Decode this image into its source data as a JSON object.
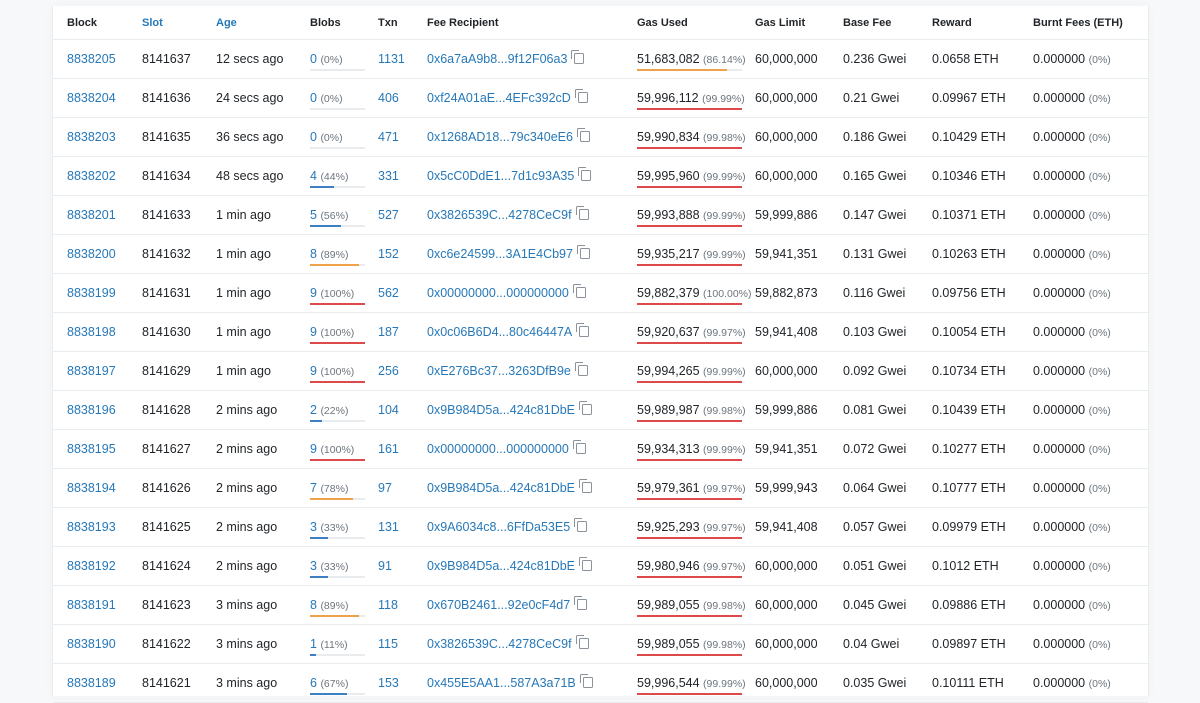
{
  "columns": [
    {
      "label": "Block",
      "sortable": false
    },
    {
      "label": "Slot",
      "sortable": true
    },
    {
      "label": "Age",
      "sortable": true
    },
    {
      "label": "Blobs",
      "sortable": false
    },
    {
      "label": "Txn",
      "sortable": false
    },
    {
      "label": "Fee Recipient",
      "sortable": false
    },
    {
      "label": "Gas Used",
      "sortable": false
    },
    {
      "label": "Gas Limit",
      "sortable": false
    },
    {
      "label": "Base Fee",
      "sortable": false
    },
    {
      "label": "Reward",
      "sortable": false
    },
    {
      "label": "Burnt Fees (ETH)",
      "sortable": false
    }
  ],
  "colors": {
    "link": "#2678b8",
    "blob_bar_low": "#3e7fc1",
    "blob_bar_high": "#f0a14b",
    "blob_bar_full": "#de4a4a",
    "gas_bar_mid": "#f0a14b",
    "gas_bar_high": "#de4a4a"
  },
  "rows": [
    {
      "block": "8838205",
      "slot": "8141637",
      "age": "12 secs ago",
      "blobs": "0",
      "blobs_pct": "(0%)",
      "blobs_frac": 0.0,
      "txn": "1131",
      "fee_recipient": "0x6a7aA9b8...9f12F06a3",
      "gas_used": "51,683,082",
      "gas_pct": "(86.14%)",
      "gas_frac": 0.8614,
      "gas_limit": "60,000,000",
      "base_fee": "0.236 Gwei",
      "reward": "0.0658 ETH",
      "burnt": "0.000000",
      "burnt_pct": "(0%)"
    },
    {
      "block": "8838204",
      "slot": "8141636",
      "age": "24 secs ago",
      "blobs": "0",
      "blobs_pct": "(0%)",
      "blobs_frac": 0.0,
      "txn": "406",
      "fee_recipient": "0xf24A01aE...4EFc392cD",
      "gas_used": "59,996,112",
      "gas_pct": "(99.99%)",
      "gas_frac": 0.9999,
      "gas_limit": "60,000,000",
      "base_fee": "0.21 Gwei",
      "reward": "0.09967 ETH",
      "burnt": "0.000000",
      "burnt_pct": "(0%)"
    },
    {
      "block": "8838203",
      "slot": "8141635",
      "age": "36 secs ago",
      "blobs": "0",
      "blobs_pct": "(0%)",
      "blobs_frac": 0.0,
      "txn": "471",
      "fee_recipient": "0x1268AD18...79c340eE6",
      "gas_used": "59,990,834",
      "gas_pct": "(99.98%)",
      "gas_frac": 0.9998,
      "gas_limit": "60,000,000",
      "base_fee": "0.186 Gwei",
      "reward": "0.10429 ETH",
      "burnt": "0.000000",
      "burnt_pct": "(0%)"
    },
    {
      "block": "8838202",
      "slot": "8141634",
      "age": "48 secs ago",
      "blobs": "4",
      "blobs_pct": "(44%)",
      "blobs_frac": 0.44,
      "txn": "331",
      "fee_recipient": "0x5cC0DdE1...7d1c93A35",
      "gas_used": "59,995,960",
      "gas_pct": "(99.99%)",
      "gas_frac": 0.9999,
      "gas_limit": "60,000,000",
      "base_fee": "0.165 Gwei",
      "reward": "0.10346 ETH",
      "burnt": "0.000000",
      "burnt_pct": "(0%)"
    },
    {
      "block": "8838201",
      "slot": "8141633",
      "age": "1 min ago",
      "blobs": "5",
      "blobs_pct": "(56%)",
      "blobs_frac": 0.56,
      "txn": "527",
      "fee_recipient": "0x3826539C...4278CeC9f",
      "gas_used": "59,993,888",
      "gas_pct": "(99.99%)",
      "gas_frac": 0.9999,
      "gas_limit": "59,999,886",
      "base_fee": "0.147 Gwei",
      "reward": "0.10371 ETH",
      "burnt": "0.000000",
      "burnt_pct": "(0%)"
    },
    {
      "block": "8838200",
      "slot": "8141632",
      "age": "1 min ago",
      "blobs": "8",
      "blobs_pct": "(89%)",
      "blobs_frac": 0.89,
      "txn": "152",
      "fee_recipient": "0xc6e24599...3A1E4Cb97",
      "gas_used": "59,935,217",
      "gas_pct": "(99.99%)",
      "gas_frac": 0.9999,
      "gas_limit": "59,941,351",
      "base_fee": "0.131 Gwei",
      "reward": "0.10263 ETH",
      "burnt": "0.000000",
      "burnt_pct": "(0%)"
    },
    {
      "block": "8838199",
      "slot": "8141631",
      "age": "1 min ago",
      "blobs": "9",
      "blobs_pct": "(100%)",
      "blobs_frac": 1.0,
      "txn": "562",
      "fee_recipient": "0x00000000...000000000",
      "gas_used": "59,882,379",
      "gas_pct": "(100.00%)",
      "gas_frac": 1.0,
      "gas_limit": "59,882,873",
      "base_fee": "0.116 Gwei",
      "reward": "0.09756 ETH",
      "burnt": "0.000000",
      "burnt_pct": "(0%)"
    },
    {
      "block": "8838198",
      "slot": "8141630",
      "age": "1 min ago",
      "blobs": "9",
      "blobs_pct": "(100%)",
      "blobs_frac": 1.0,
      "txn": "187",
      "fee_recipient": "0x0c06B6D4...80c46447A",
      "gas_used": "59,920,637",
      "gas_pct": "(99.97%)",
      "gas_frac": 0.9997,
      "gas_limit": "59,941,408",
      "base_fee": "0.103 Gwei",
      "reward": "0.10054 ETH",
      "burnt": "0.000000",
      "burnt_pct": "(0%)"
    },
    {
      "block": "8838197",
      "slot": "8141629",
      "age": "1 min ago",
      "blobs": "9",
      "blobs_pct": "(100%)",
      "blobs_frac": 1.0,
      "txn": "256",
      "fee_recipient": "0xE276Bc37...3263DfB9e",
      "gas_used": "59,994,265",
      "gas_pct": "(99.99%)",
      "gas_frac": 0.9999,
      "gas_limit": "60,000,000",
      "base_fee": "0.092 Gwei",
      "reward": "0.10734 ETH",
      "burnt": "0.000000",
      "burnt_pct": "(0%)"
    },
    {
      "block": "8838196",
      "slot": "8141628",
      "age": "2 mins ago",
      "blobs": "2",
      "blobs_pct": "(22%)",
      "blobs_frac": 0.22,
      "txn": "104",
      "fee_recipient": "0x9B984D5a...424c81DbE",
      "gas_used": "59,989,987",
      "gas_pct": "(99.98%)",
      "gas_frac": 0.9998,
      "gas_limit": "59,999,886",
      "base_fee": "0.081 Gwei",
      "reward": "0.10439 ETH",
      "burnt": "0.000000",
      "burnt_pct": "(0%)"
    },
    {
      "block": "8838195",
      "slot": "8141627",
      "age": "2 mins ago",
      "blobs": "9",
      "blobs_pct": "(100%)",
      "blobs_frac": 1.0,
      "txn": "161",
      "fee_recipient": "0x00000000...000000000",
      "gas_used": "59,934,313",
      "gas_pct": "(99.99%)",
      "gas_frac": 0.9999,
      "gas_limit": "59,941,351",
      "base_fee": "0.072 Gwei",
      "reward": "0.10277 ETH",
      "burnt": "0.000000",
      "burnt_pct": "(0%)"
    },
    {
      "block": "8838194",
      "slot": "8141626",
      "age": "2 mins ago",
      "blobs": "7",
      "blobs_pct": "(78%)",
      "blobs_frac": 0.78,
      "txn": "97",
      "fee_recipient": "0x9B984D5a...424c81DbE",
      "gas_used": "59,979,361",
      "gas_pct": "(99.97%)",
      "gas_frac": 0.9997,
      "gas_limit": "59,999,943",
      "base_fee": "0.064 Gwei",
      "reward": "0.10777 ETH",
      "burnt": "0.000000",
      "burnt_pct": "(0%)"
    },
    {
      "block": "8838193",
      "slot": "8141625",
      "age": "2 mins ago",
      "blobs": "3",
      "blobs_pct": "(33%)",
      "blobs_frac": 0.33,
      "txn": "131",
      "fee_recipient": "0x9A6034c8...6FfDa53E5",
      "gas_used": "59,925,293",
      "gas_pct": "(99.97%)",
      "gas_frac": 0.9997,
      "gas_limit": "59,941,408",
      "base_fee": "0.057 Gwei",
      "reward": "0.09979 ETH",
      "burnt": "0.000000",
      "burnt_pct": "(0%)"
    },
    {
      "block": "8838192",
      "slot": "8141624",
      "age": "2 mins ago",
      "blobs": "3",
      "blobs_pct": "(33%)",
      "blobs_frac": 0.33,
      "txn": "91",
      "fee_recipient": "0x9B984D5a...424c81DbE",
      "gas_used": "59,980,946",
      "gas_pct": "(99.97%)",
      "gas_frac": 0.9997,
      "gas_limit": "60,000,000",
      "base_fee": "0.051 Gwei",
      "reward": "0.1012 ETH",
      "burnt": "0.000000",
      "burnt_pct": "(0%)"
    },
    {
      "block": "8838191",
      "slot": "8141623",
      "age": "3 mins ago",
      "blobs": "8",
      "blobs_pct": "(89%)",
      "blobs_frac": 0.89,
      "txn": "118",
      "fee_recipient": "0x670B2461...92e0cF4d7",
      "gas_used": "59,989,055",
      "gas_pct": "(99.98%)",
      "gas_frac": 0.9998,
      "gas_limit": "60,000,000",
      "base_fee": "0.045 Gwei",
      "reward": "0.09886 ETH",
      "burnt": "0.000000",
      "burnt_pct": "(0%)"
    },
    {
      "block": "8838190",
      "slot": "8141622",
      "age": "3 mins ago",
      "blobs": "1",
      "blobs_pct": "(11%)",
      "blobs_frac": 0.11,
      "txn": "115",
      "fee_recipient": "0x3826539C...4278CeC9f",
      "gas_used": "59,989,055",
      "gas_pct": "(99.98%)",
      "gas_frac": 0.9998,
      "gas_limit": "60,000,000",
      "base_fee": "0.04 Gwei",
      "reward": "0.09897 ETH",
      "burnt": "0.000000",
      "burnt_pct": "(0%)"
    },
    {
      "block": "8838189",
      "slot": "8141621",
      "age": "3 mins ago",
      "blobs": "6",
      "blobs_pct": "(67%)",
      "blobs_frac": 0.67,
      "txn": "153",
      "fee_recipient": "0x455E5AA1...587A3a71B",
      "gas_used": "59,996,544",
      "gas_pct": "(99.99%)",
      "gas_frac": 0.9999,
      "gas_limit": "60,000,000",
      "base_fee": "0.035 Gwei",
      "reward": "0.10111 ETH",
      "burnt": "0.000000",
      "burnt_pct": "(0%)"
    }
  ]
}
